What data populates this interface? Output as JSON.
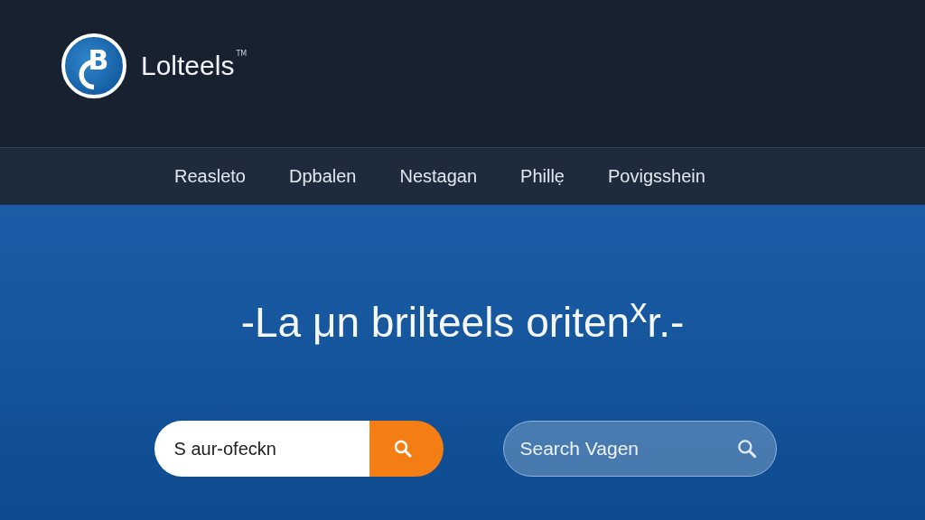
{
  "header": {
    "logo_letter": "B",
    "brand": "Lolteels",
    "trademark": "TM"
  },
  "nav": {
    "items": [
      {
        "label": "Reasleto"
      },
      {
        "label": "Dpbalen"
      },
      {
        "label": "Nestagan"
      },
      {
        "label": "Phillẹ"
      },
      {
        "label": "Povigsshein"
      }
    ]
  },
  "hero": {
    "headline": "-La μn brilteels oriten$^{x}$r.-"
  },
  "search_fields": [
    {
      "kind": "button",
      "value": "S aur-ofeckn"
    },
    {
      "kind": "inline",
      "placeholder": "Search Vagen"
    }
  ]
}
